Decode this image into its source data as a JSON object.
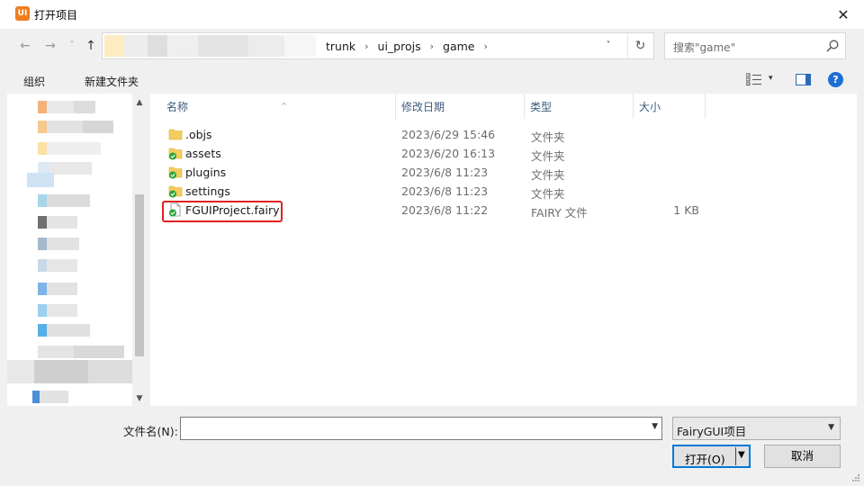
{
  "window": {
    "title": "打开项目",
    "app_icon_text": "UI",
    "close_glyph": "✕"
  },
  "nav": {
    "back": "←",
    "forward": "→",
    "history": "˅",
    "up": "↑"
  },
  "address": {
    "crumbs": [
      "trunk",
      "ui_projs",
      "game"
    ],
    "separator": "›",
    "dropdown": "˅",
    "refresh": "↻"
  },
  "search": {
    "placeholder": "搜索\"game\""
  },
  "toolbar": {
    "organize": "组织",
    "new_folder": "新建文件夹",
    "view_chevron": "▾",
    "help": "?"
  },
  "columns": {
    "name": "名称",
    "date": "修改日期",
    "type": "类型",
    "size": "大小"
  },
  "files": [
    {
      "name": ".objs",
      "date": "2023/6/29 15:46",
      "type": "文件夹",
      "size": "",
      "icon": "folder-icon",
      "synced": false
    },
    {
      "name": "assets",
      "date": "2023/6/20 16:13",
      "type": "文件夹",
      "size": "",
      "icon": "folder-icon",
      "synced": true
    },
    {
      "name": "plugins",
      "date": "2023/6/8 11:23",
      "type": "文件夹",
      "size": "",
      "icon": "folder-icon",
      "synced": true
    },
    {
      "name": "settings",
      "date": "2023/6/8 11:23",
      "type": "文件夹",
      "size": "",
      "icon": "folder-icon",
      "synced": true
    },
    {
      "name": "FGUIProject.fairy",
      "date": "2023/6/8 11:22",
      "type": "FAIRY 文件",
      "size": "1 KB",
      "icon": "file-icon",
      "synced": true
    }
  ],
  "bottom": {
    "filename_label": "文件名(N):",
    "filename_value": "",
    "filetype": "FairyGUI项目",
    "open_label": "打开(O)",
    "cancel_label": "取消"
  },
  "colors": {
    "accent": "#0078d7",
    "highlight_box": "#e02020",
    "folder": "#f5cd5c",
    "sync_check": "#2aa33b",
    "app_icon": "#f07d1e"
  }
}
